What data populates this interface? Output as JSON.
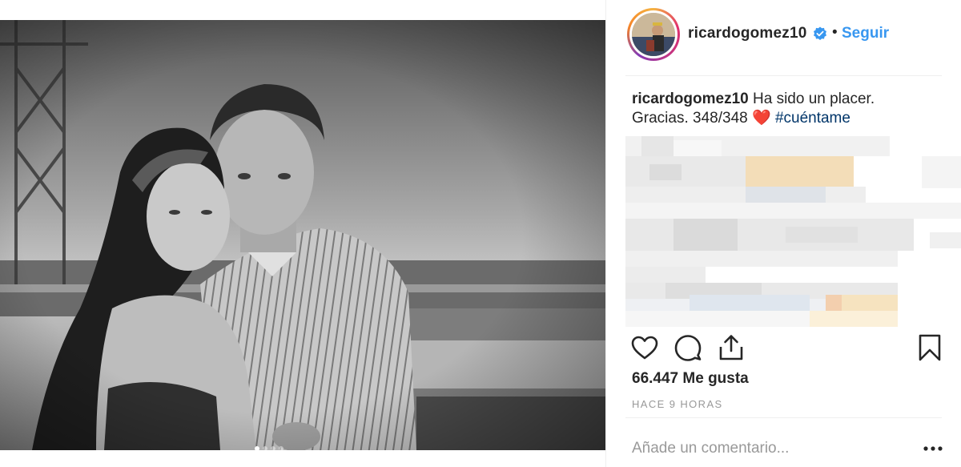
{
  "post": {
    "image": {
      "description_icon": "photo",
      "carousel": {
        "total": 4,
        "active": 1
      }
    },
    "author": {
      "username": "ricardogomez10",
      "verified": true,
      "separator": "•",
      "follow_label": "Seguir"
    },
    "caption": {
      "username": "ricardogomez10",
      "text_line1": "Ha sido un placer.",
      "text_line2": "Gracias. 348/348",
      "emoji": "❤️",
      "hashtag": "#cuéntame"
    },
    "actions": {
      "like_icon": "heart-icon",
      "comment_icon": "comment-icon",
      "share_icon": "share-icon",
      "save_icon": "bookmark-icon"
    },
    "likes": "66.447 Me gusta",
    "timestamp": "HACE 9 HORAS",
    "comment": {
      "placeholder": "Añade un comentario...",
      "more_icon": "more-options-icon"
    }
  },
  "colors": {
    "accent": "#3897f0",
    "hashtag": "#003569",
    "heart": "#e0245e",
    "muted": "#999999"
  }
}
